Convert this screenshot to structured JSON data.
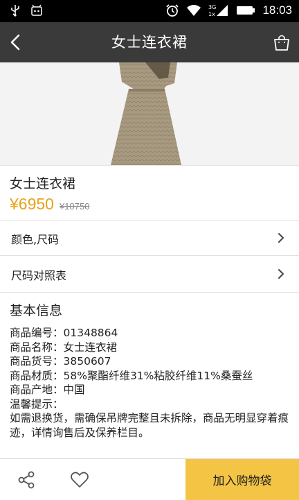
{
  "status_bar": {
    "time": "18:03",
    "icons": [
      "usb-icon",
      "notification-app-icon",
      "alarm-icon",
      "wifi-icon",
      "signal-3g-icon",
      "battery-icon"
    ]
  },
  "header": {
    "title": "女士连衣裙",
    "back_icon": "back-arrow-icon",
    "bag_icon": "shopping-bag-icon"
  },
  "product": {
    "name": "女士连衣裙",
    "price": "¥6950",
    "original_price": "¥10750",
    "price_color": "#e8a21a"
  },
  "options": [
    {
      "label": "颜色,尺码"
    },
    {
      "label": "尺码对照表"
    }
  ],
  "basic_info": {
    "title": "基本信息",
    "lines": [
      "商品编号：01348864",
      "商品名称：女士连衣裙",
      "商品货号：3850607",
      "商品材质：58%聚酯纤维31%粘胶纤维11%桑蚕丝",
      "商品产地：中国",
      "温馨提示：",
      "如需退换货，需确保吊牌完整且未拆除，商品无明显穿着痕迹，详情询售后及保养栏目。"
    ]
  },
  "bottom_bar": {
    "share_icon": "share-icon",
    "favorite_icon": "heart-icon",
    "add_to_cart_label": "加入购物袋",
    "add_to_cart_color": "#f4c545"
  }
}
